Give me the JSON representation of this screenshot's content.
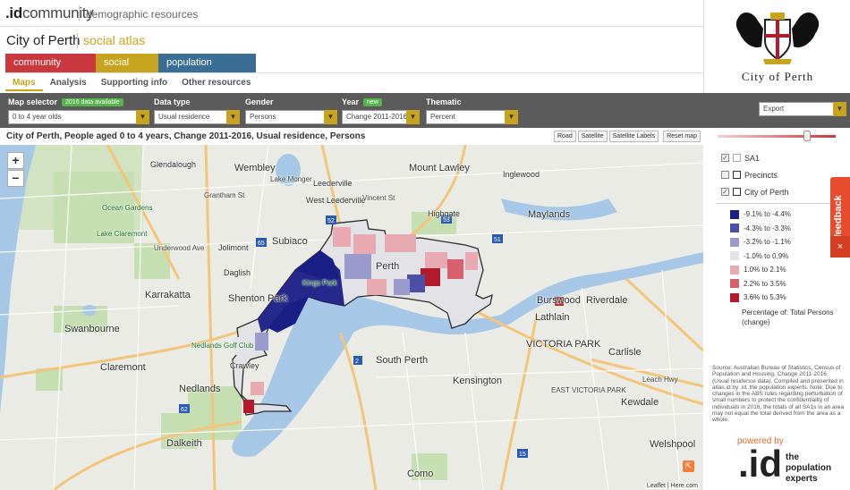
{
  "header": {
    "logo_prefix": ".id",
    "logo_suffix": "community",
    "tagline": "demographic resources",
    "council": "City of Perth",
    "atlas": "social atlas"
  },
  "product_tabs": [
    {
      "label": "community profile",
      "color": "#c9373f"
    },
    {
      "label": "social atlas",
      "color": "#c8a31d"
    },
    {
      "label": "population forecast",
      "color": "#3a6e95"
    }
  ],
  "subnav": [
    "Maps",
    "Analysis",
    "Supporting info",
    "Other resources"
  ],
  "selectors": {
    "map_selector": {
      "label": "Map selector",
      "badge": "2016 data available",
      "value": "0 to 4 year olds"
    },
    "data_type": {
      "label": "Data type",
      "value": "Usual residence"
    },
    "gender": {
      "label": "Gender",
      "value": "Persons"
    },
    "year": {
      "label": "Year",
      "badge": "new",
      "value": "Change 2011-2016"
    },
    "thematic": {
      "label": "Thematic",
      "value": "Percent"
    },
    "export": {
      "value": "Export"
    }
  },
  "map": {
    "title": "City of Perth, People aged 0 to 4 years, Change 2011-2016, Usual residence, Persons",
    "buttons": [
      "Road",
      "Satellite",
      "Satellite Labels",
      "Reset map"
    ],
    "zoom_in": "+",
    "zoom_out": "−",
    "attribution": "Leaflet | Here.com",
    "places": {
      "glendalough": "Glendalough",
      "wembley": "Wembley",
      "lake_monger": "Lake Monger",
      "leederville": "Leederville",
      "mount_lawley": "Mount Lawley",
      "inglewood": "Inglewood",
      "grantham": "Grantham St",
      "west_leederville": "West Leederville",
      "vincent": "Vincent St",
      "highgate": "Highgate",
      "maylands": "Maylands",
      "ocean_gardens": "Ocean Gardens",
      "lake_claremont": "Lake Claremont",
      "kings_park": "Kings Park",
      "underwood": "Underwood Ave",
      "jolimont": "Jolimont",
      "subiaco": "Subiaco",
      "daglish": "Daglish",
      "karrakatta": "Karrakatta",
      "perth": "Perth",
      "burswood": "Burswood",
      "lathlain": "Lathlain",
      "riverdale": "Riverdale",
      "shenton_park": "Shenton Park",
      "swanbourne": "Swanbourne",
      "nedlands_golf": "Nedlands Golf Club",
      "mt_claremont": "Claremont",
      "victoria_park": "VICTORIA PARK",
      "south_perth": "South Perth",
      "kensington": "Kensington",
      "carlisle": "Carlisle",
      "welshpool": "Welshpool",
      "nedlands": "Nedlands",
      "dalkeith": "Dalkeith",
      "east_victoria_park": "EAST VICTORIA PARK",
      "kewdale": "Kewdale",
      "leach_hwy": "Leach Hwy",
      "crawley": "Crawley",
      "como": "Como"
    }
  },
  "layers": [
    {
      "label": "SA1",
      "checked": true
    },
    {
      "label": "Precincts",
      "checked": false
    },
    {
      "label": "City of Perth",
      "checked": true
    }
  ],
  "legend": {
    "items": [
      {
        "label": "-9.1% to -4.4%",
        "color": "#1a1f86"
      },
      {
        "label": "-4.3% to -3.3%",
        "color": "#4b4fa6"
      },
      {
        "label": "-3.2% to -1.1%",
        "color": "#9a9bcc"
      },
      {
        "label": "-1.0% to 0.9%",
        "color": "#e3e3e8"
      },
      {
        "label": "1.0% to 2.1%",
        "color": "#e8aab0"
      },
      {
        "label": "2.2% to 3.5%",
        "color": "#d6606c"
      },
      {
        "label": "3.6% to 5.3%",
        "color": "#b31b2c"
      }
    ],
    "note": "Percentage of: Total Persons (change)"
  },
  "source_note": "Source: Australian Bureau of Statistics, Census of Population and Housing, Change 2011-2016. (Usual residence data). Compiled and presented in atlas.id by .id, the population experts. Note: Due to changes in the ABS rules regarding perturbation of small numbers to protect the confidentiality of individuals in 2016, the totals of all SA1s in an area may not equal the total derived from the area as a whole.",
  "brand": {
    "city_name": "City of Perth",
    "powered_by": "powered by",
    "id_mark": ".id",
    "id_tagline": "the\npopulation\nexperts"
  },
  "feedback": {
    "label": "feedback",
    "close": "×"
  },
  "colors": {
    "gold": "#c8a31d",
    "red": "#c9373f",
    "blue": "#3a6e95"
  }
}
